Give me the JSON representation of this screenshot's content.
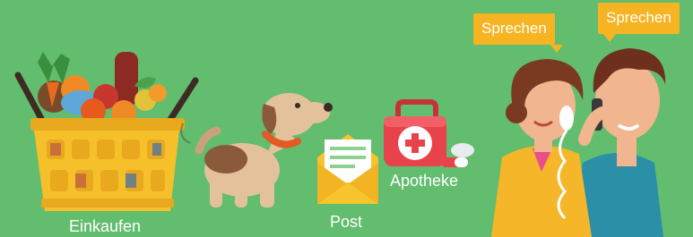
{
  "labels": {
    "shopping": "Einkaufen",
    "post": "Post",
    "pharmacy": "Apotheke"
  },
  "bubbles": {
    "woman": "Sprechen",
    "man": "Sprechen"
  },
  "icons": {
    "shopping": "shopping-basket-icon",
    "dog": "dog-icon",
    "post": "envelope-icon",
    "pharmacy": "first-aid-kit-icon",
    "pills": "pills-icon",
    "talk": "phone-conversation-icon"
  },
  "colors": {
    "background": "#62bd6e",
    "basket": "#f5c02a",
    "envelope": "#f6c42c",
    "first_aid": "#e8424a",
    "bubble": "#f6b423"
  }
}
